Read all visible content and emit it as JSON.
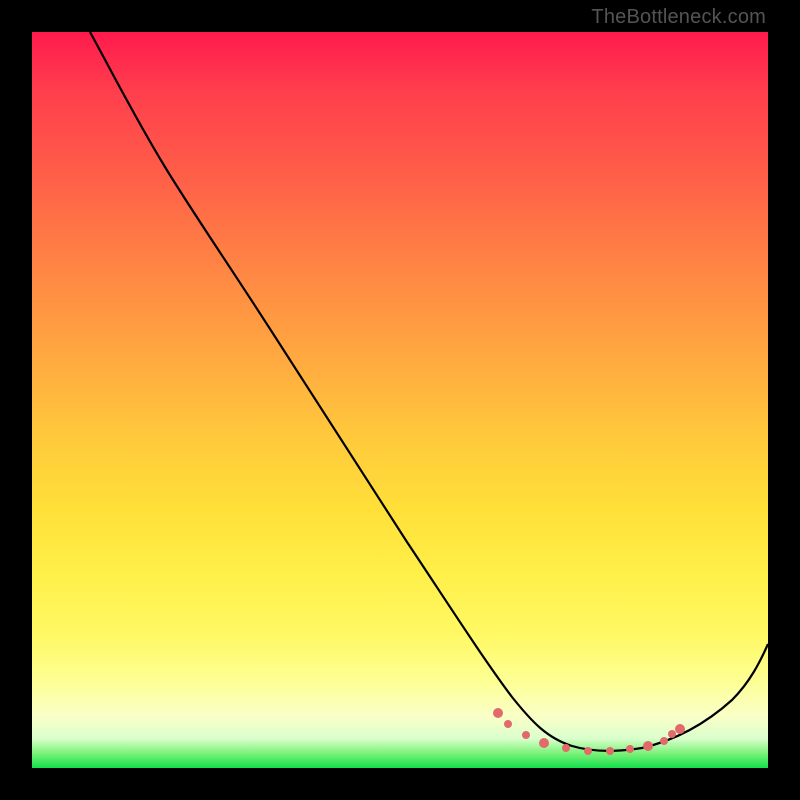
{
  "watermark": "TheBottleneck.com",
  "chart_data": {
    "type": "line",
    "title": "",
    "xlabel": "",
    "ylabel": "",
    "xlim": [
      0,
      100
    ],
    "ylim": [
      0,
      100
    ],
    "series": [
      {
        "name": "curve",
        "x": [
          8,
          12,
          18,
          25,
          32,
          40,
          48,
          55,
          62,
          68,
          72,
          76,
          80,
          84,
          88,
          92,
          96,
          100
        ],
        "values": [
          100,
          96,
          88,
          78,
          68,
          56,
          44,
          34,
          24,
          15,
          10,
          6,
          4,
          3,
          4,
          8,
          14,
          22
        ]
      }
    ],
    "markers": {
      "name": "highlight-dots",
      "x": [
        62,
        64,
        67,
        70,
        73,
        76,
        79,
        82,
        83.5,
        85
      ],
      "y": [
        6.0,
        5.0,
        4.0,
        3.5,
        3.0,
        3.0,
        3.2,
        4.0,
        5.5,
        7.5
      ]
    },
    "gradient_stops": [
      {
        "pct": 0,
        "color": "#ff1a4d"
      },
      {
        "pct": 50,
        "color": "#ffc93c"
      },
      {
        "pct": 85,
        "color": "#fdff92"
      },
      {
        "pct": 100,
        "color": "#13e04b"
      }
    ]
  }
}
